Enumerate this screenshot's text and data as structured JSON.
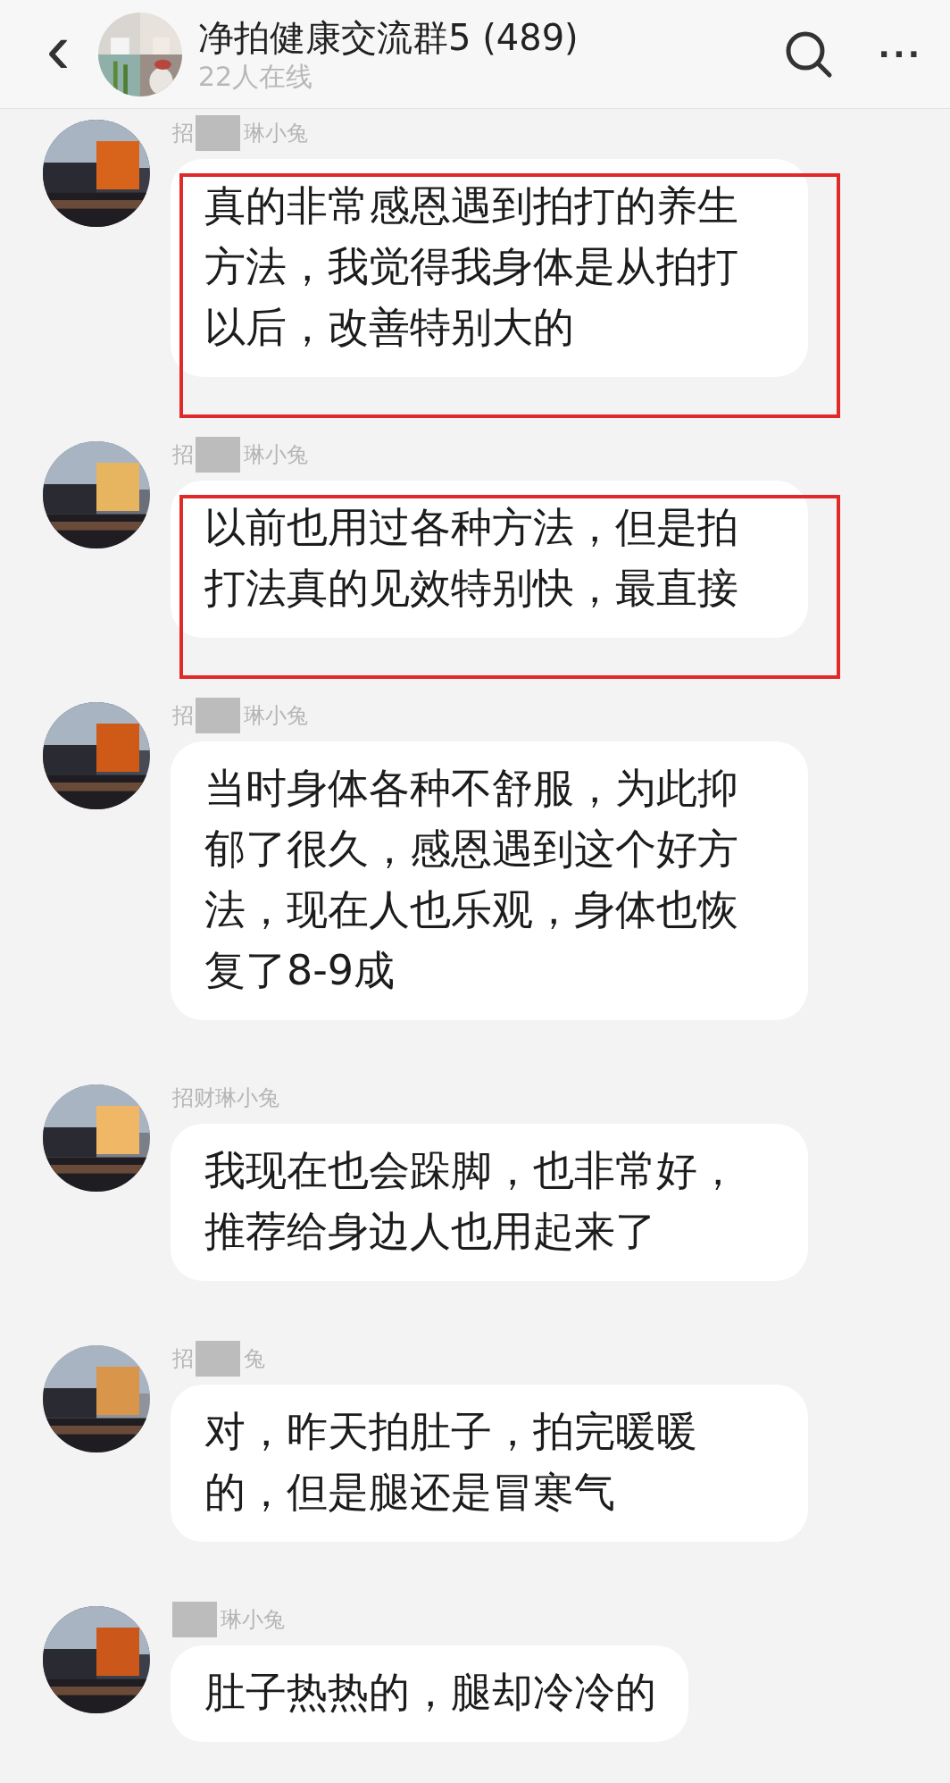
{
  "header": {
    "back": "‹",
    "title": "净拍健康交流群5 (489)",
    "subtitle": "22人在线",
    "more": "···"
  },
  "messages": [
    {
      "sender": [
        {
          "kind": "text",
          "text": "招"
        },
        {
          "kind": "redaction"
        },
        {
          "kind": "text",
          "text": "琳小兔"
        }
      ],
      "text": "真的非常感恩遇到拍打的养生方法，我觉得我身体是从拍打以后，改善特别大的",
      "highlighted": true
    },
    {
      "sender": [
        {
          "kind": "text",
          "text": "招"
        },
        {
          "kind": "redaction"
        },
        {
          "kind": "text",
          "text": "琳小兔"
        }
      ],
      "text": "以前也用过各种方法，但是拍打法真的见效特别快，最直接",
      "highlighted": true
    },
    {
      "sender": [
        {
          "kind": "text",
          "text": "招"
        },
        {
          "kind": "redaction"
        },
        {
          "kind": "text",
          "text": "琳小兔"
        }
      ],
      "text": "当时身体各种不舒服，为此抑郁了很久，感恩遇到这个好方法，现在人也乐观，身体也恢复了8-9成",
      "highlighted": false
    },
    {
      "sender": [
        {
          "kind": "text",
          "text": "招财琳小兔"
        }
      ],
      "text": "我现在也会跺脚，也非常好，推荐给身边人也用起来了",
      "highlighted": false
    },
    {
      "sender": [
        {
          "kind": "text",
          "text": "招"
        },
        {
          "kind": "redaction"
        },
        {
          "kind": "text",
          "text": "兔"
        }
      ],
      "text": "对，昨天拍肚子，拍完暖暖的，但是腿还是冒寒气",
      "highlighted": false
    },
    {
      "sender": [
        {
          "kind": "redaction"
        },
        {
          "kind": "text",
          "text": "琳小兔"
        }
      ],
      "text": "肚子热热的，腿却冷冷的",
      "highlighted": false
    }
  ]
}
